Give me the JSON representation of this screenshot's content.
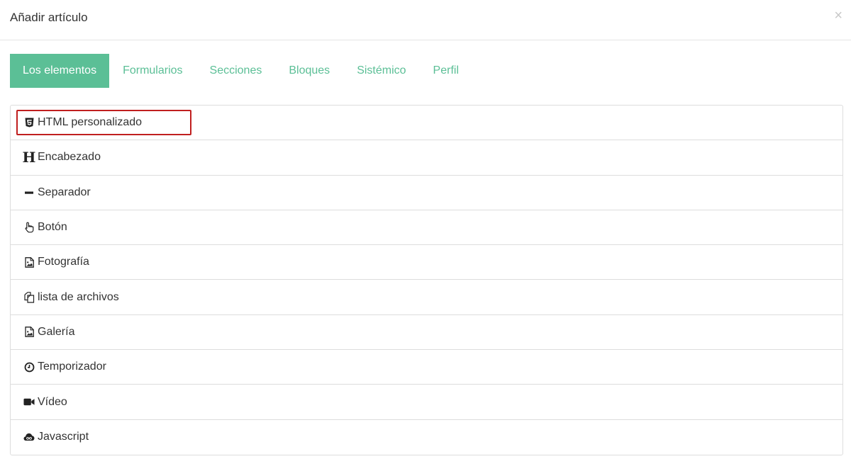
{
  "modal": {
    "title": "Añadir artículo",
    "close_label": "×"
  },
  "tabs": [
    {
      "label": "Los elementos",
      "active": true
    },
    {
      "label": "Formularios",
      "active": false
    },
    {
      "label": "Secciones",
      "active": false
    },
    {
      "label": "Bloques",
      "active": false
    },
    {
      "label": "Sistémico",
      "active": false
    },
    {
      "label": "Perfil",
      "active": false
    }
  ],
  "items": [
    {
      "label": "HTML personalizado",
      "icon": "html5-icon",
      "highlighted": true
    },
    {
      "label": "Encabezado",
      "icon": "heading-icon",
      "icon_glyph": "H"
    },
    {
      "label": "Separador",
      "icon": "minus-icon"
    },
    {
      "label": "Botón",
      "icon": "hand-pointer-icon"
    },
    {
      "label": "Fotografía",
      "icon": "image-file-icon"
    },
    {
      "label": "lista de archivos",
      "icon": "files-icon"
    },
    {
      "label": "Galería",
      "icon": "image-file-icon"
    },
    {
      "label": "Temporizador",
      "icon": "clock-icon"
    },
    {
      "label": "Vídeo",
      "icon": "video-camera-icon"
    },
    {
      "label": "Javascript",
      "icon": "cloud-icon"
    }
  ],
  "colors": {
    "accent": "#5bbf96",
    "highlight_border": "#c01f1f",
    "border": "#dddddd"
  }
}
